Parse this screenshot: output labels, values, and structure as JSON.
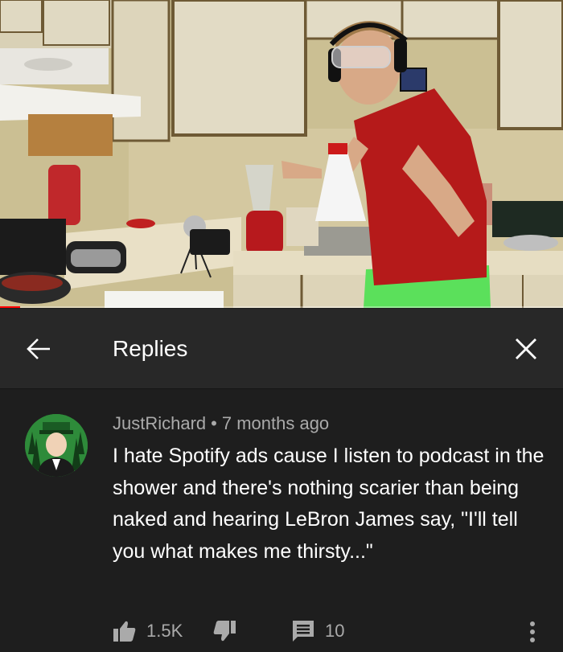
{
  "video": {
    "progress_percent": 3.6
  },
  "header": {
    "back_icon": "arrow-left-icon",
    "title": "Replies",
    "close_icon": "close-icon"
  },
  "comment": {
    "author": "JustRichard",
    "separator": "•",
    "time": "7 months ago",
    "text": "I hate Spotify ads cause I listen to podcast in the shower and there's nothing scarier than being naked and hearing LeBron James say, \"I'll tell you what makes me thirsty...\"",
    "likes": "1.5K",
    "replies": "10",
    "icons": {
      "like": "thumbs-up-icon",
      "dislike": "thumbs-down-icon",
      "reply": "comment-icon",
      "more": "more-vertical-icon"
    }
  },
  "colors": {
    "background": "#1e1e1e",
    "header_background": "#282828",
    "secondary_text": "#aaaaaa",
    "progress": "#ff0000"
  }
}
